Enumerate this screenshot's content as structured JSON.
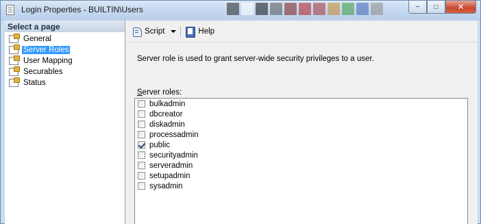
{
  "window": {
    "title": "Login Properties - BUILTIN\\Users",
    "minimize_label": "−",
    "maximize_label": "□",
    "close_label": "✕",
    "swatch_colors": [
      "#222222",
      "#ffffff",
      "#111111",
      "#555555",
      "#7a1a1a",
      "#b21b1b",
      "#a33030",
      "#c8882a",
      "#3b9a3b",
      "#3d63b5",
      "#8b8b8b"
    ]
  },
  "left_panel": {
    "header": "Select a page",
    "items": [
      {
        "label": "General",
        "icon": "page-wrench-icon",
        "selected": false
      },
      {
        "label": "Server Roles",
        "icon": "page-wrench-icon",
        "selected": true
      },
      {
        "label": "User Mapping",
        "icon": "page-wrench-icon",
        "selected": false
      },
      {
        "label": "Securables",
        "icon": "page-wrench-icon",
        "selected": false
      },
      {
        "label": "Status",
        "icon": "page-wrench-icon",
        "selected": false
      }
    ]
  },
  "toolbar": {
    "script_label": "Script",
    "help_label": "Help",
    "script_icon": "script-icon",
    "help_icon": "help-book-icon"
  },
  "main": {
    "description": "Server role is used to grant server-wide security privileges to a user.",
    "roles_label_accel": "S",
    "roles_label_rest": "erver roles:",
    "roles": [
      {
        "name": "bulkadmin",
        "checked": false
      },
      {
        "name": "dbcreator",
        "checked": false
      },
      {
        "name": "diskadmin",
        "checked": false
      },
      {
        "name": "processadmin",
        "checked": false
      },
      {
        "name": "public",
        "checked": true
      },
      {
        "name": "securityadmin",
        "checked": false
      },
      {
        "name": "serveradmin",
        "checked": false
      },
      {
        "name": "setupadmin",
        "checked": false
      },
      {
        "name": "sysadmin",
        "checked": false
      }
    ]
  }
}
